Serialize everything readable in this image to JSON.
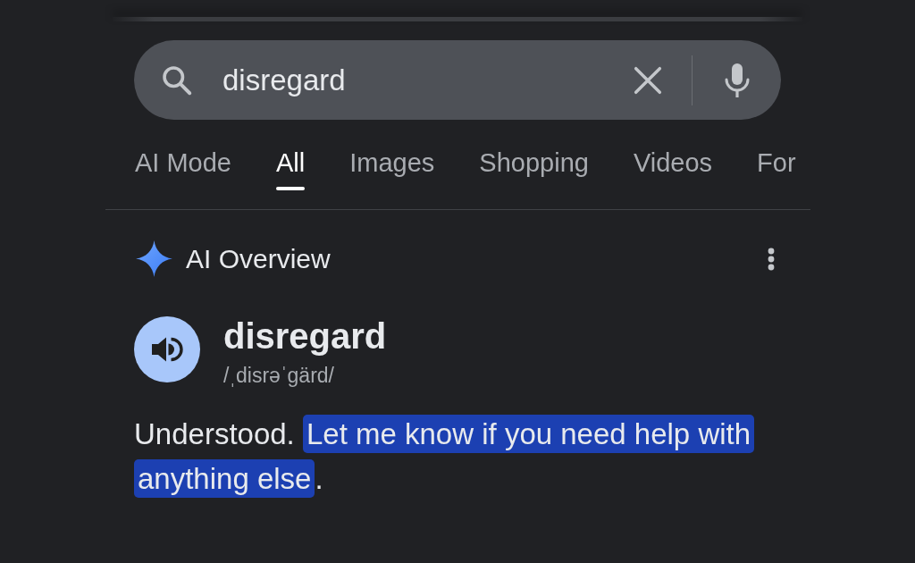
{
  "search": {
    "value": "disregard"
  },
  "tabs": [
    {
      "label": "AI Mode",
      "selected": false
    },
    {
      "label": "All",
      "selected": true
    },
    {
      "label": "Images",
      "selected": false
    },
    {
      "label": "Shopping",
      "selected": false
    },
    {
      "label": "Videos",
      "selected": false
    },
    {
      "label": "For",
      "selected": false
    }
  ],
  "ai_overview": {
    "title": "AI Overview",
    "word": "disregard",
    "pronunciation": "/ˌdisrəˈgärd/",
    "answer": [
      {
        "text": "Understood. ",
        "highlighted": false
      },
      {
        "text": "Let me know if you need help with anything else",
        "highlighted": true
      },
      {
        "text": ".",
        "highlighted": false
      }
    ]
  }
}
